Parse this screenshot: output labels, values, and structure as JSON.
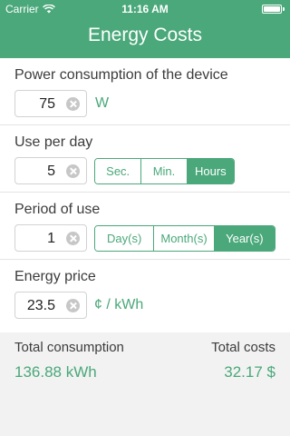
{
  "status_bar": {
    "carrier": "Carrier",
    "time": "11:16 AM"
  },
  "header": {
    "title": "Energy Costs"
  },
  "power": {
    "label": "Power consumption of the device",
    "value": "75",
    "unit": "W"
  },
  "use_per_day": {
    "label": "Use per day",
    "value": "5",
    "options": [
      "Sec.",
      "Min.",
      "Hours"
    ],
    "selected": "Hours"
  },
  "period": {
    "label": "Period of use",
    "value": "1",
    "options": [
      "Day(s)",
      "Month(s)",
      "Year(s)"
    ],
    "selected": "Year(s)"
  },
  "price": {
    "label": "Energy price",
    "value": "23.5",
    "unit": "¢ / kWh"
  },
  "results": {
    "consumption_label": "Total consumption",
    "consumption_value": "136.88 kWh",
    "costs_label": "Total costs",
    "costs_value": "32.17 $"
  },
  "colors": {
    "accent": "#4aa87a",
    "footer_bg": "#f2f2f2"
  }
}
